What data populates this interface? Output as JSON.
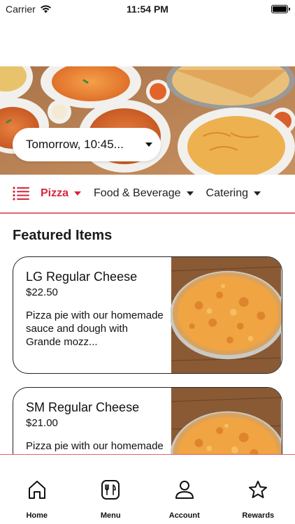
{
  "status_bar": {
    "carrier": "Carrier",
    "time": "11:54 PM"
  },
  "order_time": {
    "label": "Tomorrow, 10:45..."
  },
  "categories": [
    {
      "label": "Pizza",
      "active": true
    },
    {
      "label": "Food & Beverage",
      "active": false
    },
    {
      "label": "Catering",
      "active": false
    }
  ],
  "featured": {
    "title": "Featured Items",
    "items": [
      {
        "name": "LG Regular Cheese",
        "price": "$22.50",
        "description": "Pizza pie with our homemade sauce and dough with Grande mozz..."
      },
      {
        "name": "SM Regular Cheese",
        "price": "$21.00",
        "description": "Pizza pie with our homemade sauce and"
      }
    ]
  },
  "tabs": [
    {
      "label": "Home",
      "icon": "home-icon"
    },
    {
      "label": "Menu",
      "icon": "menu-fork-knife-icon"
    },
    {
      "label": "Account",
      "icon": "person-icon"
    },
    {
      "label": "Rewards",
      "icon": "star-icon"
    }
  ],
  "colors": {
    "accent": "#d7263d",
    "divider": "#e06373"
  }
}
